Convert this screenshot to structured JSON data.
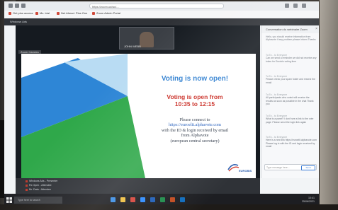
{
  "browser": {
    "url": "https://zoom.us/wc/...",
    "bookmarks": [
      "Get plus access",
      "Ms. trial",
      "Net Ahead. Plus One",
      "Zoom Admin Portal"
    ]
  },
  "meeting": {
    "top_label": "Windows Ads",
    "camera_label": "JOHN WEBB",
    "name_tag": "Zoom Camera",
    "participants": [
      "Windows Ads - Presenter",
      "Rx Open - Attendee",
      "Mr. Data - Attendee"
    ]
  },
  "slide": {
    "title": "Voting is now open!",
    "red_line1": "Voting is open from",
    "red_line2": "10:35 to 12:15",
    "body_line1": "Please connect to",
    "body_link": "https://euroelit.alphavote.com",
    "body_line2": "with the ID & login received by email",
    "body_line3": "from Alphavote",
    "body_line4": "(european central secretary)",
    "logo_text": "EUROBIS"
  },
  "chat": {
    "title": "Conversation du webinaire Zoom",
    "messages": [
      {
        "who": "",
        "text": "Hello, you should receive information from Alphavote if any problem please inform Thanks"
      },
      {
        "who": "To Ev... to Everyone",
        "text": "Can we send a reminder we did not receive any token for Eurobis voting time"
      },
      {
        "who": "To Ev... to Everyone",
        "text": "Please check your spam folder and resend the email"
      },
      {
        "who": "To Ev... to Everyone",
        "text": "All participants who voted will receive the results as soon as possible in the chat Thank you"
      },
      {
        "who": "To Ev... to Everyone",
        "text": "What is a panel? I don't see a link to the vote page. Please send the login link again"
      },
      {
        "who": "To Ev... to Everyone",
        "text": "Here is a new link https://euroelit.alphavote.com Please log in with the ID and login received by email"
      }
    ],
    "input_placeholder": "Type message here...",
    "send_label": "Send"
  },
  "taskbar": {
    "search_placeholder": "Type here to search",
    "clock_time": "10:41",
    "clock_date": "25/06/2021"
  }
}
